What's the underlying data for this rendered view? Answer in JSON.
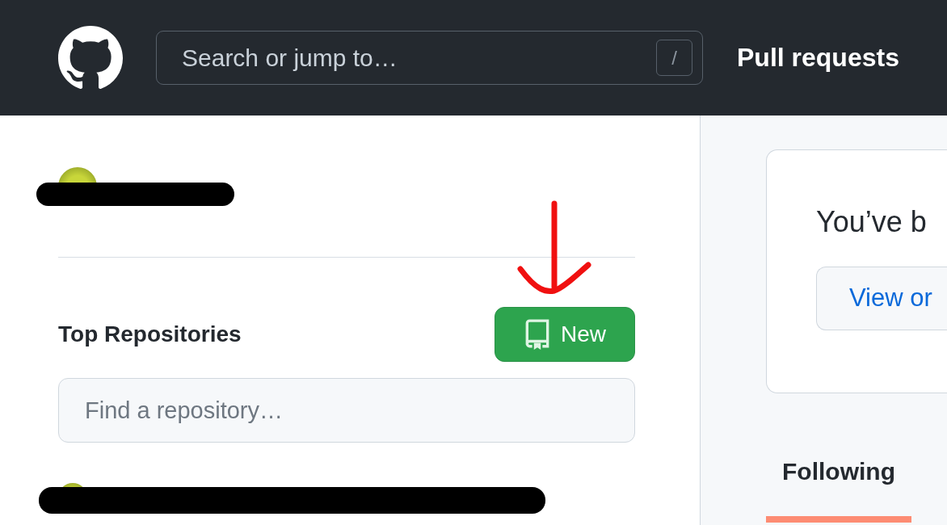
{
  "header": {
    "search": {
      "placeholder": "Search or jump to…",
      "shortcut": "/"
    },
    "nav": [
      {
        "label": "Pull requests"
      }
    ]
  },
  "sidebar": {
    "top_repositories": {
      "title": "Top Repositories",
      "new_button": "New",
      "filter": {
        "placeholder": "Find a repository…"
      }
    }
  },
  "feed": {
    "notice": {
      "text": "You’ve b",
      "button": "View or"
    },
    "tabs": [
      {
        "label": "Following",
        "selected": true
      }
    ]
  }
}
